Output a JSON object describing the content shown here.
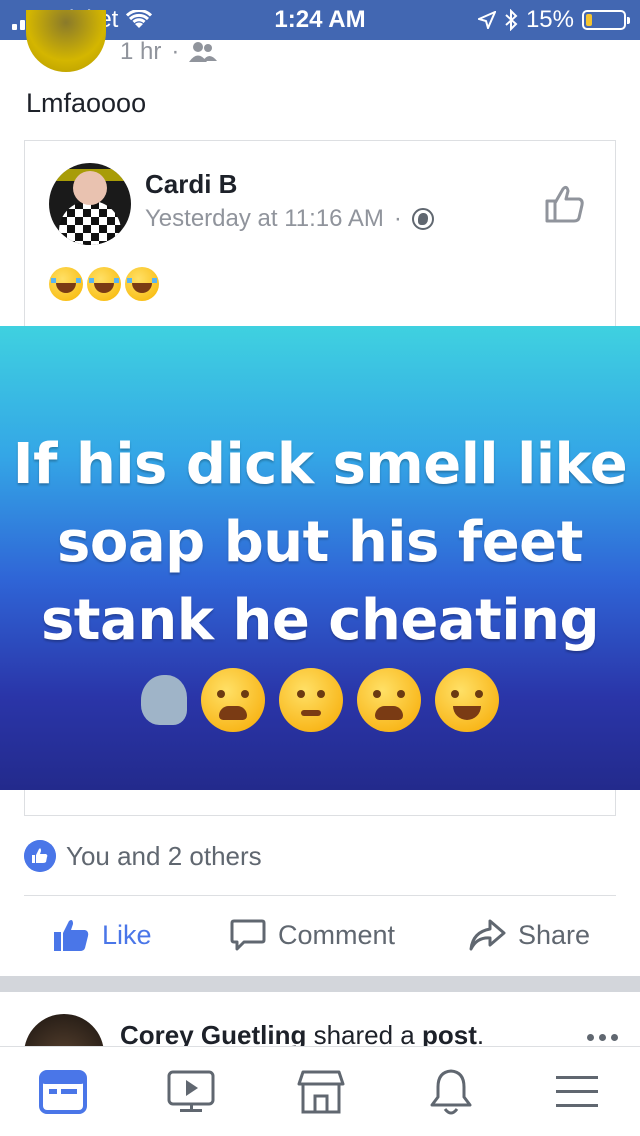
{
  "status_bar": {
    "carrier": "cricket",
    "time": "1:24 AM",
    "battery_percent": "15%",
    "battery_level": 0.15,
    "bar_color": "#4267b2"
  },
  "outer_post": {
    "time_ago": "1 hr",
    "separator": "·",
    "audience_icon": "friends-icon",
    "text": "Lmfaoooo"
  },
  "shared_post": {
    "author": "Cardi B",
    "time": "Yesterday at 11:16 AM",
    "separator": "·",
    "audience_icon": "globe-icon",
    "caption_emojis": [
      "laughing-tears",
      "laughing-tears",
      "laughing-tears"
    ],
    "image": {
      "lines": [
        "If his dick smell like",
        "soap but his feet",
        "stank he cheating"
      ],
      "emojis": [
        "speaking-head",
        "weary-face",
        "thinking-face",
        "tired-face",
        "laughing-tears"
      ]
    }
  },
  "reactions": {
    "summary": "You and 2 others"
  },
  "actions": {
    "like": "Like",
    "comment": "Comment",
    "share": "Share"
  },
  "next_post": {
    "author": "Corey Guetling",
    "action_text": " shared a ",
    "object": "post",
    "end": "."
  },
  "bottom_nav": [
    "news-feed-icon",
    "watch-icon",
    "marketplace-icon",
    "notifications-icon",
    "menu-icon"
  ],
  "colors": {
    "accent": "#4a76e8",
    "muted": "#90949c"
  }
}
